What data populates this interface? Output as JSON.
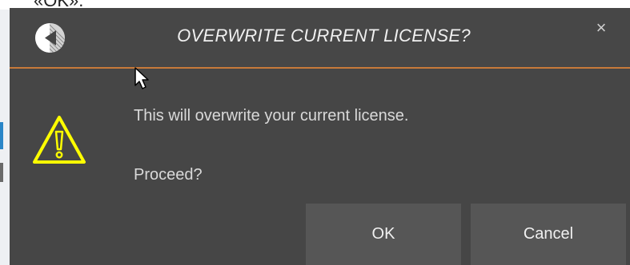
{
  "background": {
    "top_text": "«OK».",
    "accent_color": "#2a86c8"
  },
  "dialog": {
    "title": "OVERWRITE CURRENT LICENSE?",
    "close_glyph": "×",
    "logo_icon": "app-logo-icon",
    "warning_icon": "warning-triangle-icon",
    "message": "This will overwrite your current license.",
    "question": "Proceed?",
    "buttons": {
      "ok_label": "OK",
      "cancel_label": "Cancel"
    },
    "colors": {
      "background": "#464646",
      "divider": "#c87a3a",
      "warning": "#ffff00",
      "button": "#565656"
    }
  }
}
